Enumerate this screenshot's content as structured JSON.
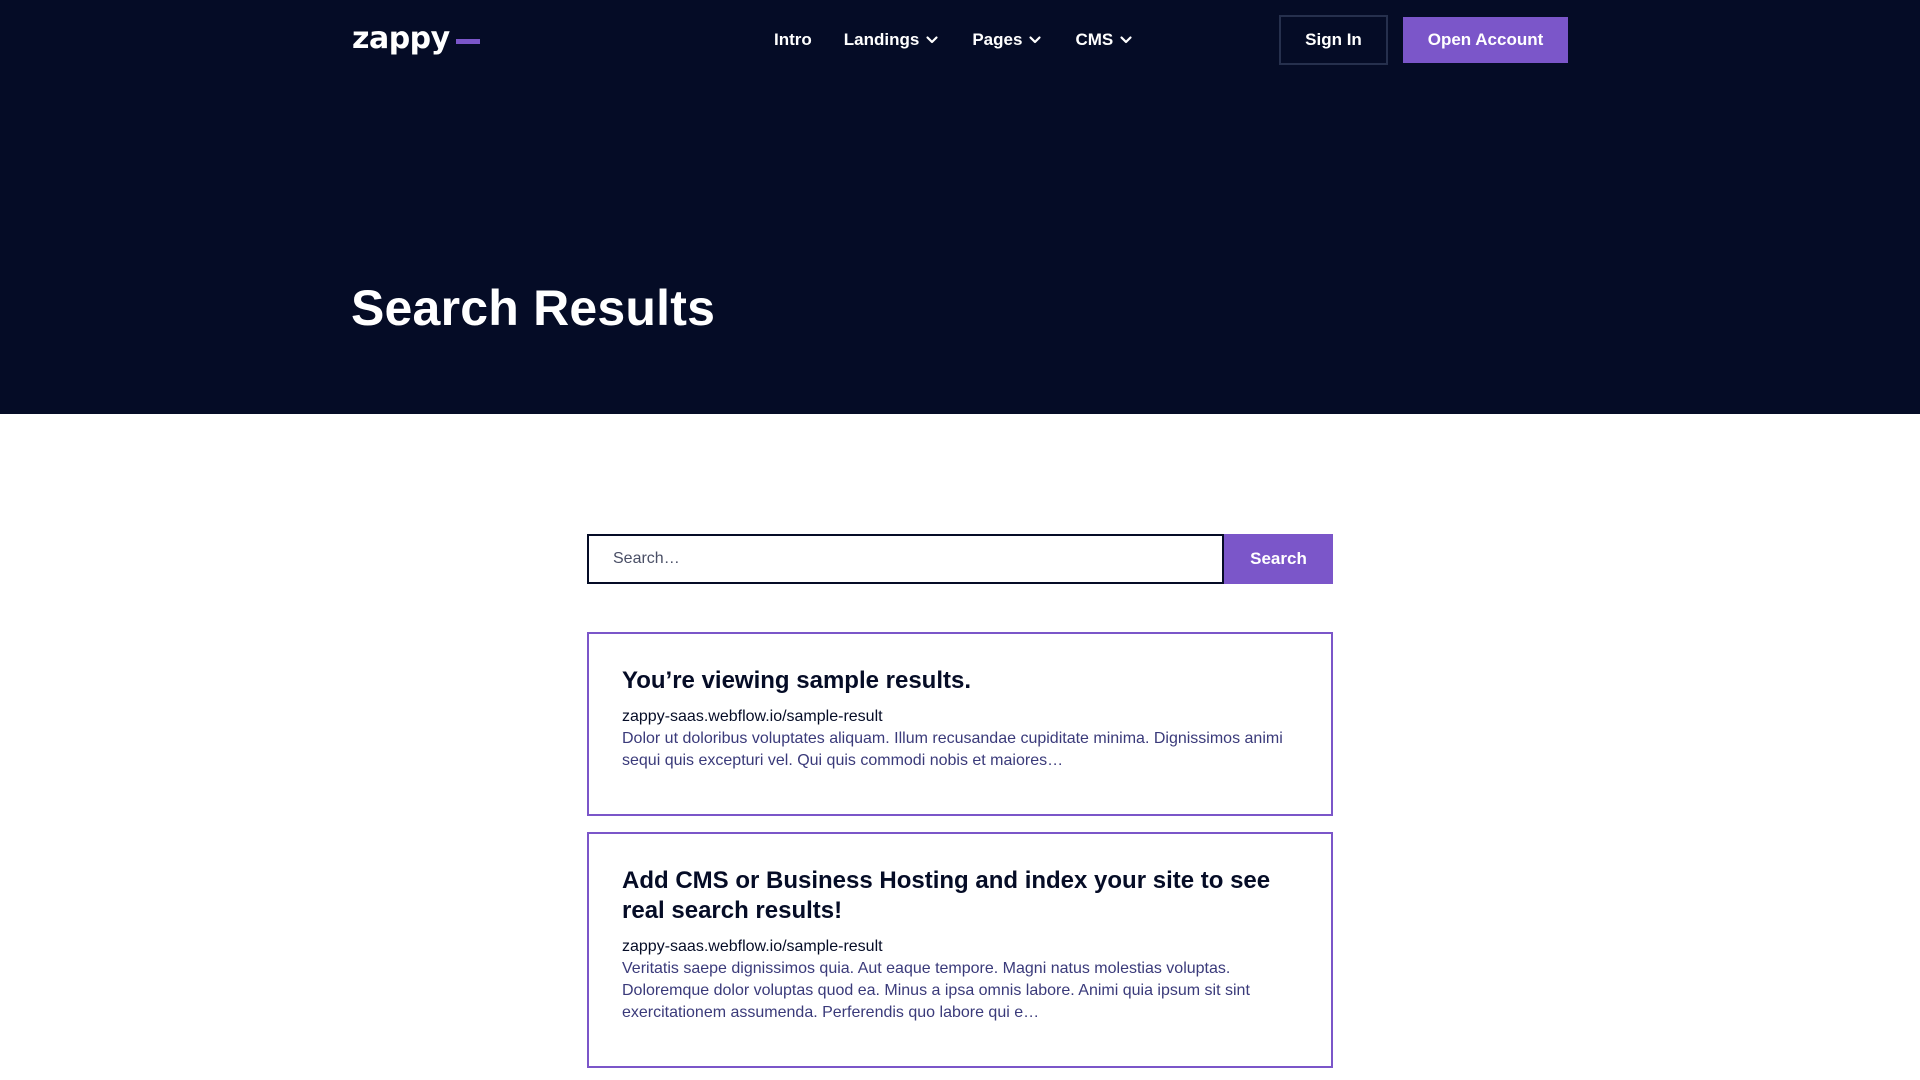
{
  "header": {
    "brand": "zappy",
    "nav": [
      {
        "label": "Intro",
        "has_dropdown": false
      },
      {
        "label": "Landings",
        "has_dropdown": true
      },
      {
        "label": "Pages",
        "has_dropdown": true
      },
      {
        "label": "CMS",
        "has_dropdown": true
      }
    ],
    "sign_in_label": "Sign In",
    "open_account_label": "Open Account",
    "page_title": "Search Results"
  },
  "search": {
    "placeholder": "Search…",
    "value": "",
    "button_label": "Search"
  },
  "results": [
    {
      "title": "You’re viewing sample results.",
      "url": "zappy-saas.webflow.io/sample-result",
      "snippet": "Dolor ut doloribus voluptates aliquam. Illum recusandae cupiditate minima. Dignissimos animi sequi quis excepturi vel. Qui quis commodi nobis et maiores…"
    },
    {
      "title": "Add CMS or Business Hosting and index your site to see real search results!",
      "url": "zappy-saas.webflow.io/sample-result",
      "snippet": "Veritatis saepe dignissimos quia. Aut eaque tempore. Magni natus molestias voluptas. Doloremque dolor voluptas quod ea. Minus a ipsa omnis labore. Animi quia ipsum sit sint exercitationem assumenda. Perferendis quo labore qui e…"
    }
  ],
  "colors": {
    "dark_background": "#050c26",
    "accent": "#7b56c9",
    "snippet_text": "#3a3a7a"
  },
  "icons": {
    "dropdown": "chevron-down-icon"
  }
}
